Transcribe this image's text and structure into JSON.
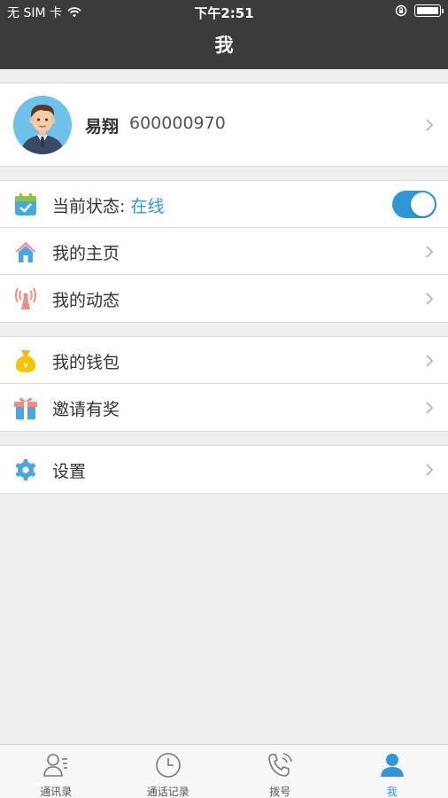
{
  "status_bar": {
    "carrier": "无 SIM 卡",
    "time": "下午2:51"
  },
  "nav": {
    "title": "我"
  },
  "profile": {
    "name": "易翔",
    "id": "600000970"
  },
  "menu": {
    "status_label": "当前状态:",
    "status_value": "在线",
    "homepage": "我的主页",
    "moments": "我的动态",
    "wallet": "我的钱包",
    "invite": "邀请有奖",
    "settings": "设置"
  },
  "toggle": {
    "on": true
  },
  "tabs": [
    {
      "label": "通讯录"
    },
    {
      "label": "通话记录"
    },
    {
      "label": "拨号"
    },
    {
      "label": "我"
    }
  ],
  "colors": {
    "accent": "#2e97d8",
    "header": "#3c3a3b",
    "background": "#efefef"
  }
}
